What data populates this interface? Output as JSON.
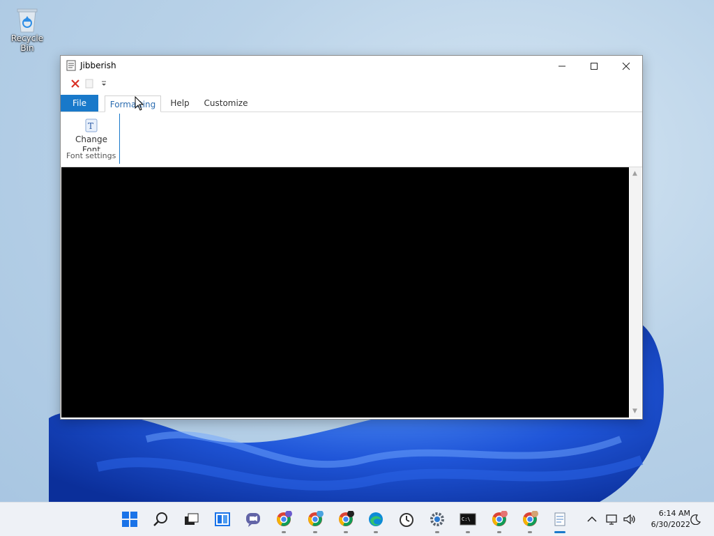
{
  "desktop": {
    "recycle_bin_label": "Recycle Bin"
  },
  "window": {
    "title": "Jibberish",
    "quick_access": [
      "close-icon",
      "new-icon",
      "dropdown-icon"
    ],
    "tabs": {
      "file": "File",
      "formatting": "Formatting",
      "help": "Help",
      "customize": "Customize"
    },
    "ribbon": {
      "change_font_line1": "Change",
      "change_font_line2": "Font",
      "group_label": "Font settings"
    },
    "editor_background": "#000000"
  },
  "taskbar": {
    "clock_time": "6:14 AM",
    "clock_date": "6/30/2022",
    "apps": [
      "windows-start-icon",
      "search-icon",
      "task-view-icon",
      "widgets-icon",
      "chat-icon",
      "chrome-icon",
      "chrome-profile-icon",
      "chrome-profile-icon",
      "edge-icon",
      "clock-app-icon",
      "settings-icon",
      "terminal-icon",
      "chrome-profile-icon",
      "chrome-profile-icon",
      "notepad-icon"
    ]
  },
  "colors": {
    "accent": "#1979ca"
  }
}
